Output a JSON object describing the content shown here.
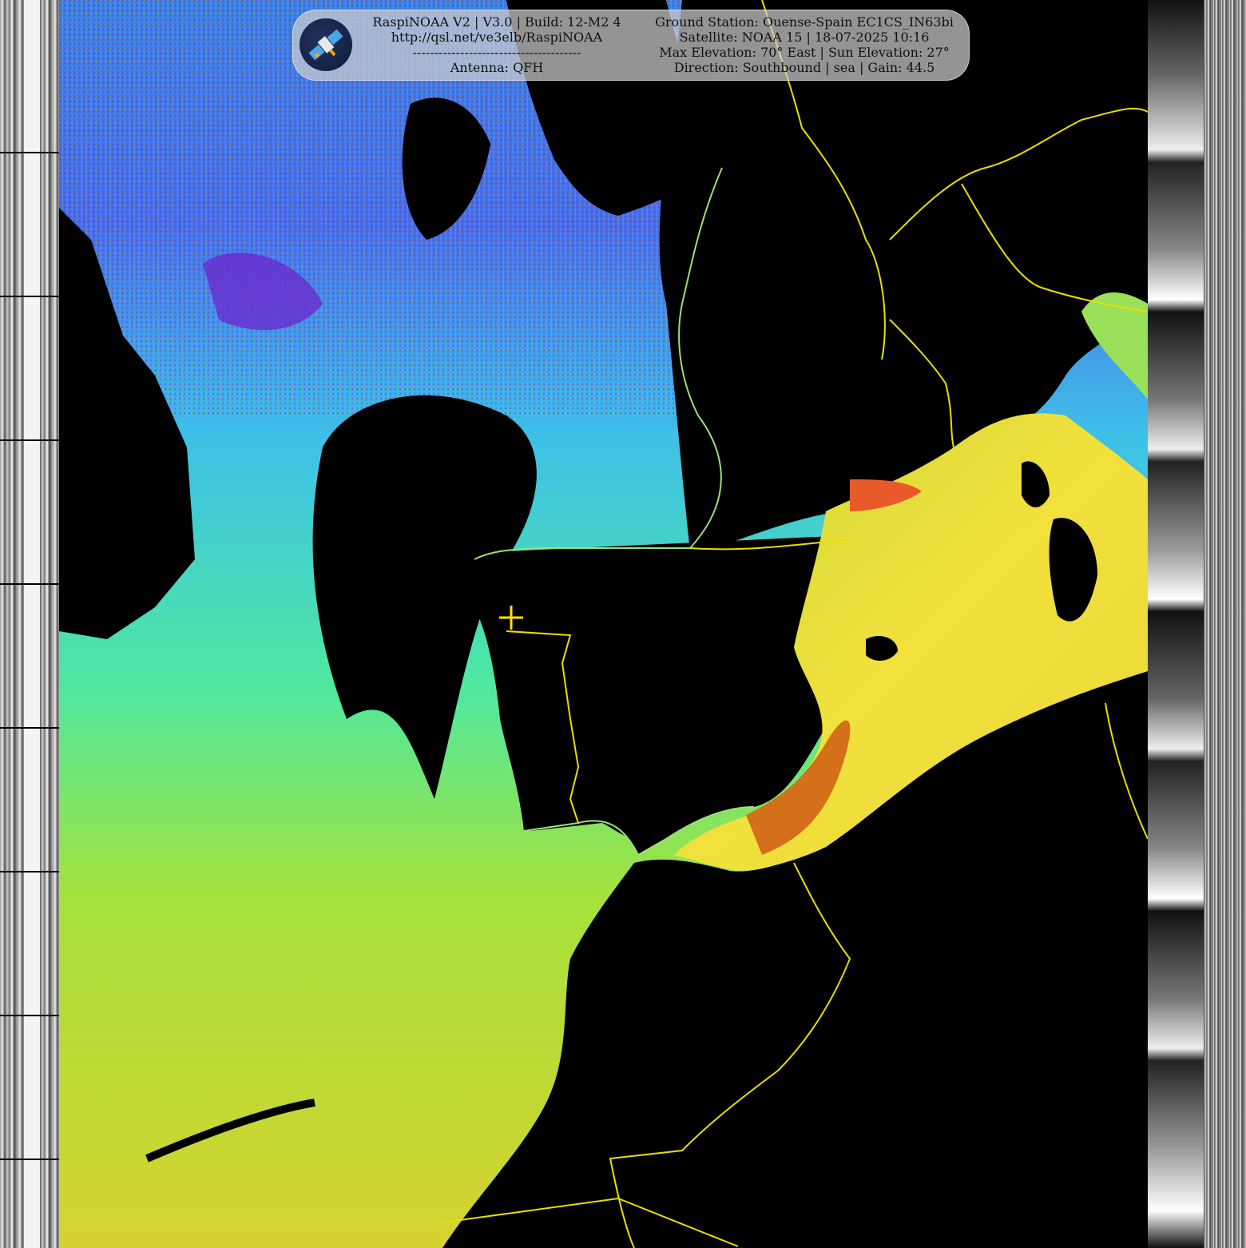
{
  "banner": {
    "left": {
      "line1": "RaspiNOAA V2 | V3.0 | Build: 12-M2 4",
      "line2": "http://qsl.net/ve3elb/RaspiNOAA",
      "line3": "---------------------------------------",
      "line4": "Antenna: QFH"
    },
    "right": {
      "line1": "Ground Station: Ouense-Spain EC1CS_IN63bi",
      "line2": "Satellite: NOAA 15 | 18-07-2025 10:16",
      "line3": "Max Elevation: 70° East | Sun Elevation: 27°",
      "line4": "Direction: Southbound | sea | Gain: 44.5"
    },
    "logo": "satellite-logo"
  },
  "colors": {
    "border_lines": "#e8e000",
    "coastline": "#9be07a",
    "ground_station_marker": "#ffe400",
    "banner_bg": "#cdcdcd"
  }
}
